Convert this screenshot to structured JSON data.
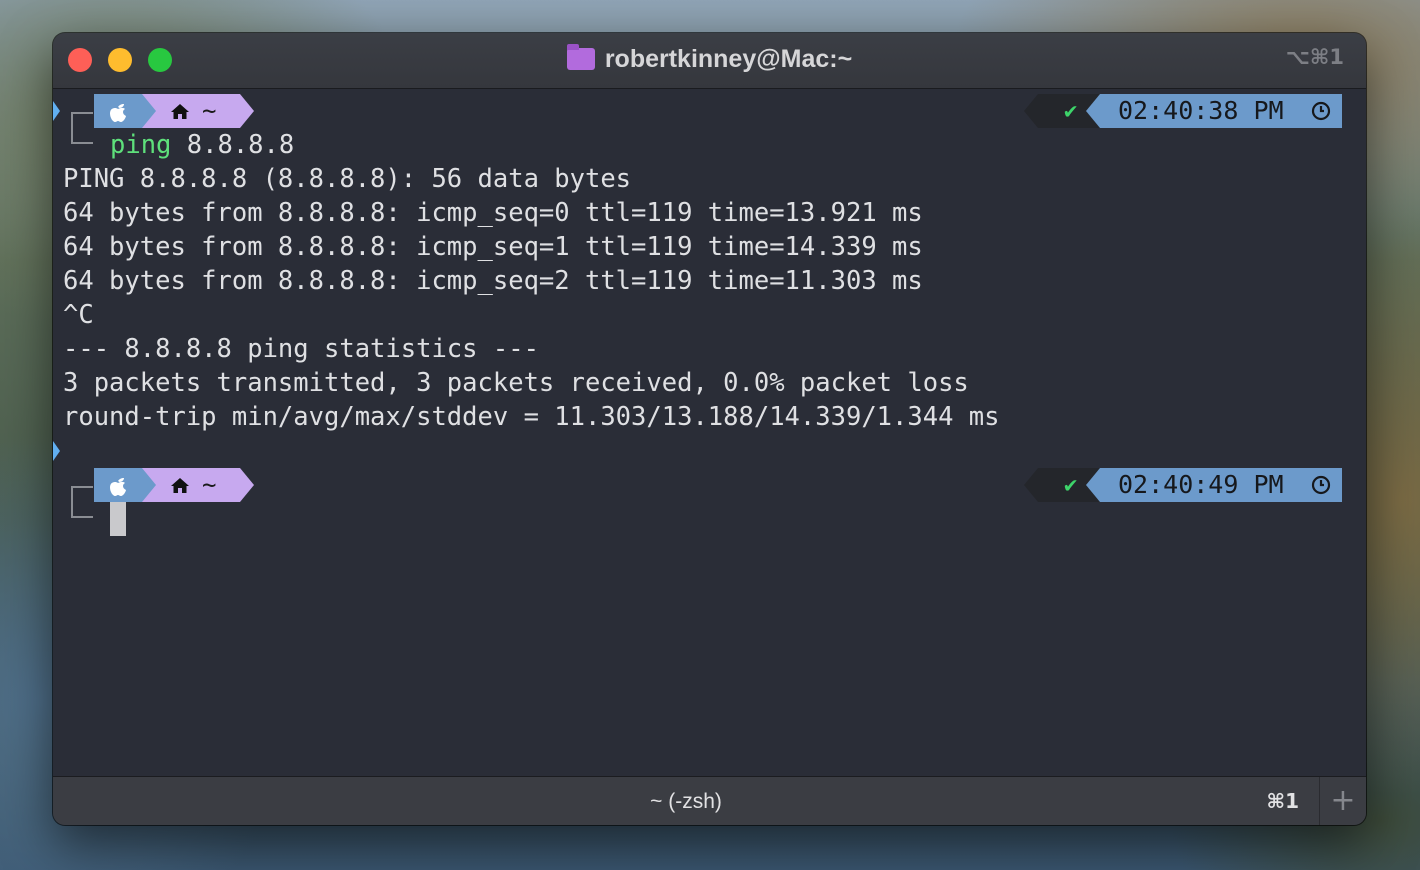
{
  "window": {
    "title": "robertkinney@Mac:~",
    "shortcut": "⌥⌘1",
    "title_icon": "folder-icon"
  },
  "prompts": [
    {
      "apple_icon": "apple-icon",
      "home_icon": "home-icon",
      "path": "~",
      "status": "✔",
      "time": "02:40:38 PM",
      "clock_icon": "clock-icon",
      "command": "ping",
      "args": " 8.8.8.8"
    },
    {
      "apple_icon": "apple-icon",
      "home_icon": "home-icon",
      "path": "~",
      "status": "✔",
      "time": "02:40:49 PM",
      "clock_icon": "clock-icon"
    }
  ],
  "output_lines": [
    "PING 8.8.8.8 (8.8.8.8): 56 data bytes",
    "64 bytes from 8.8.8.8: icmp_seq=0 ttl=119 time=13.921 ms",
    "64 bytes from 8.8.8.8: icmp_seq=1 ttl=119 time=14.339 ms",
    "64 bytes from 8.8.8.8: icmp_seq=2 ttl=119 time=11.303 ms",
    "^C",
    "--- 8.8.8.8 ping statistics ---",
    "3 packets transmitted, 3 packets received, 0.0% packet loss",
    "round-trip min/avg/max/stddev = 11.303/13.188/14.339/1.344 ms"
  ],
  "tab": {
    "label": "~ (-zsh)",
    "shortcut": "⌘1",
    "new_tab": "+"
  },
  "colors": {
    "close": "#fe5f57",
    "minimize": "#febc2e",
    "maximize": "#28c840",
    "segment_blue": "#6c9acb",
    "segment_purple": "#c7a9ef",
    "command_green": "#5ee07b",
    "terminal_bg": "#2a2d37"
  }
}
